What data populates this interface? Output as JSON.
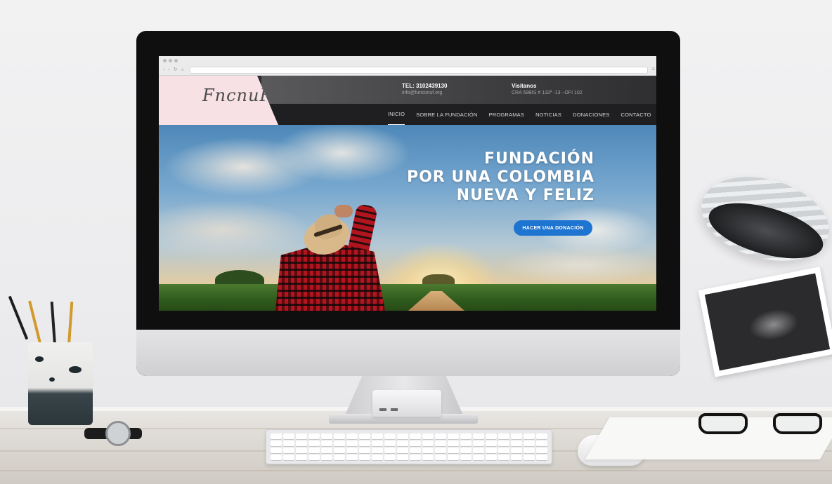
{
  "browser": {
    "nav_icons": [
      "‹",
      "›",
      "↻",
      "⌂"
    ],
    "menu_icon": "≡"
  },
  "site": {
    "logo_text": "FncnuF",
    "contact_phone": {
      "title": "TEL: 3102439130",
      "subtitle": "info@funconuf.org"
    },
    "contact_visit": {
      "title": "Visítanos",
      "subtitle": "CRA 59BIS # 132ª -13 –OFI 102"
    },
    "nav": [
      {
        "label": "INICIO",
        "active": true
      },
      {
        "label": "SOBRE LA FUNDACIÓN"
      },
      {
        "label": "PROGRAMAS"
      },
      {
        "label": "NOTICIAS"
      },
      {
        "label": "DONACIONES"
      },
      {
        "label": "CONTACTO"
      }
    ],
    "hero": {
      "line1": "FUNDACIÓN",
      "line2": "POR UNA COLOMBIA",
      "line3": "NUEVA Y FELIZ",
      "cta": "HACER UNA DONACIÓN"
    },
    "colors": {
      "accent": "#1e74d1",
      "logo_bg": "#f7e1e5",
      "header_dark": "#2b2b2d"
    }
  }
}
